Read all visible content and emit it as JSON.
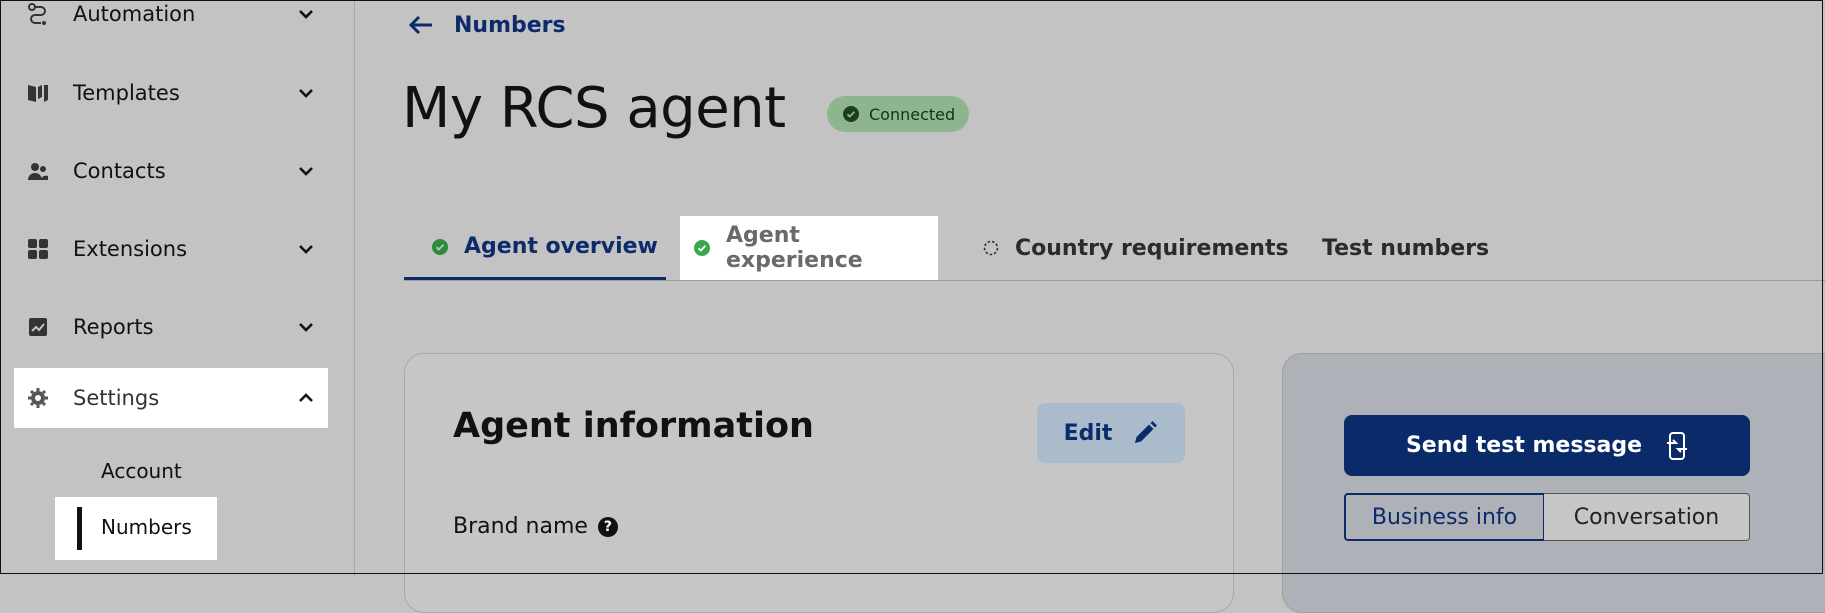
{
  "sidebar": {
    "items": [
      {
        "label": "Automation",
        "icon": "automation-icon"
      },
      {
        "label": "Templates",
        "icon": "book-icon"
      },
      {
        "label": "Contacts",
        "icon": "people-icon"
      },
      {
        "label": "Extensions",
        "icon": "grid-icon"
      },
      {
        "label": "Reports",
        "icon": "chart-icon"
      },
      {
        "label": "Settings",
        "icon": "gear-icon"
      }
    ],
    "sub_items": [
      {
        "label": "Account"
      },
      {
        "label": "Numbers"
      }
    ]
  },
  "header": {
    "back_label": "Numbers",
    "title": "My RCS agent",
    "status_badge": "Connected"
  },
  "tabs": [
    {
      "label": "Agent overview",
      "status": "complete"
    },
    {
      "label": "Agent experience",
      "status": "complete"
    },
    {
      "label": "Country requirements",
      "status": "pending"
    },
    {
      "label": "Test numbers",
      "status": "none"
    }
  ],
  "agent_card": {
    "title": "Agent information",
    "edit_label": "Edit",
    "brand_name_label": "Brand name"
  },
  "test_panel": {
    "send_label": "Send test message",
    "segments": [
      "Business info",
      "Conversation"
    ]
  },
  "colors": {
    "navy": "#0b2a6a",
    "connected_green": "#8fb58f",
    "check_green": "#2e8b3e"
  }
}
